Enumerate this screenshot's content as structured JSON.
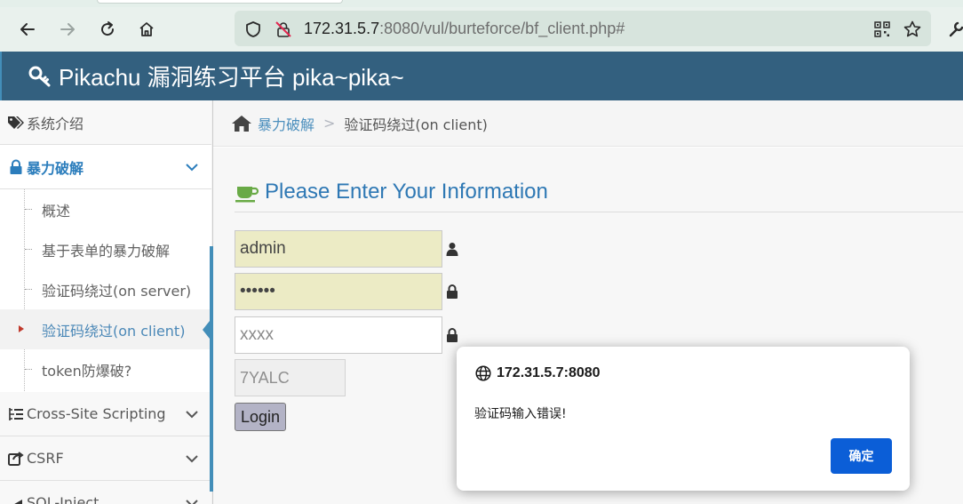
{
  "browser": {
    "url_host": "172.31.5.7",
    "url_rest": ":8080/vul/burteforce/bf_client.php#"
  },
  "header": {
    "brand": "Pikachu 漏洞练习平台 pika~pika~"
  },
  "sidebar": {
    "items": [
      {
        "label": "系统介绍",
        "icon": "tags-icon"
      },
      {
        "label": "暴力破解",
        "icon": "lock-icon",
        "expanded": true
      },
      {
        "label": "Cross-Site Scripting",
        "icon": "list-icon"
      },
      {
        "label": "CSRF",
        "icon": "share-icon"
      },
      {
        "label": "SQL-Inject",
        "icon": "sql-icon"
      }
    ],
    "subitems": [
      {
        "label": "概述"
      },
      {
        "label": "基于表单的暴力破解"
      },
      {
        "label": "验证码绕过(on server)"
      },
      {
        "label": "验证码绕过(on client)",
        "active": true
      },
      {
        "label": "token防爆破?"
      }
    ]
  },
  "breadcrumb": {
    "section": "暴力破解",
    "separator": ">",
    "current": "验证码绕过(on client)"
  },
  "form": {
    "title": "Please Enter Your Information",
    "username_value": "admin",
    "password_value": "••••••",
    "captcha_placeholder": "xxxx",
    "captcha_code": "7YALC",
    "login_label": "Login"
  },
  "dialog": {
    "origin": "172.31.5.7:8080",
    "message": "验证码输入错误!",
    "ok_label": "确定"
  },
  "colors": {
    "header_bg": "#33607f",
    "accent": "#438eb9",
    "link": "#4c8fbd",
    "dialog_button": "#0b5ed7"
  }
}
